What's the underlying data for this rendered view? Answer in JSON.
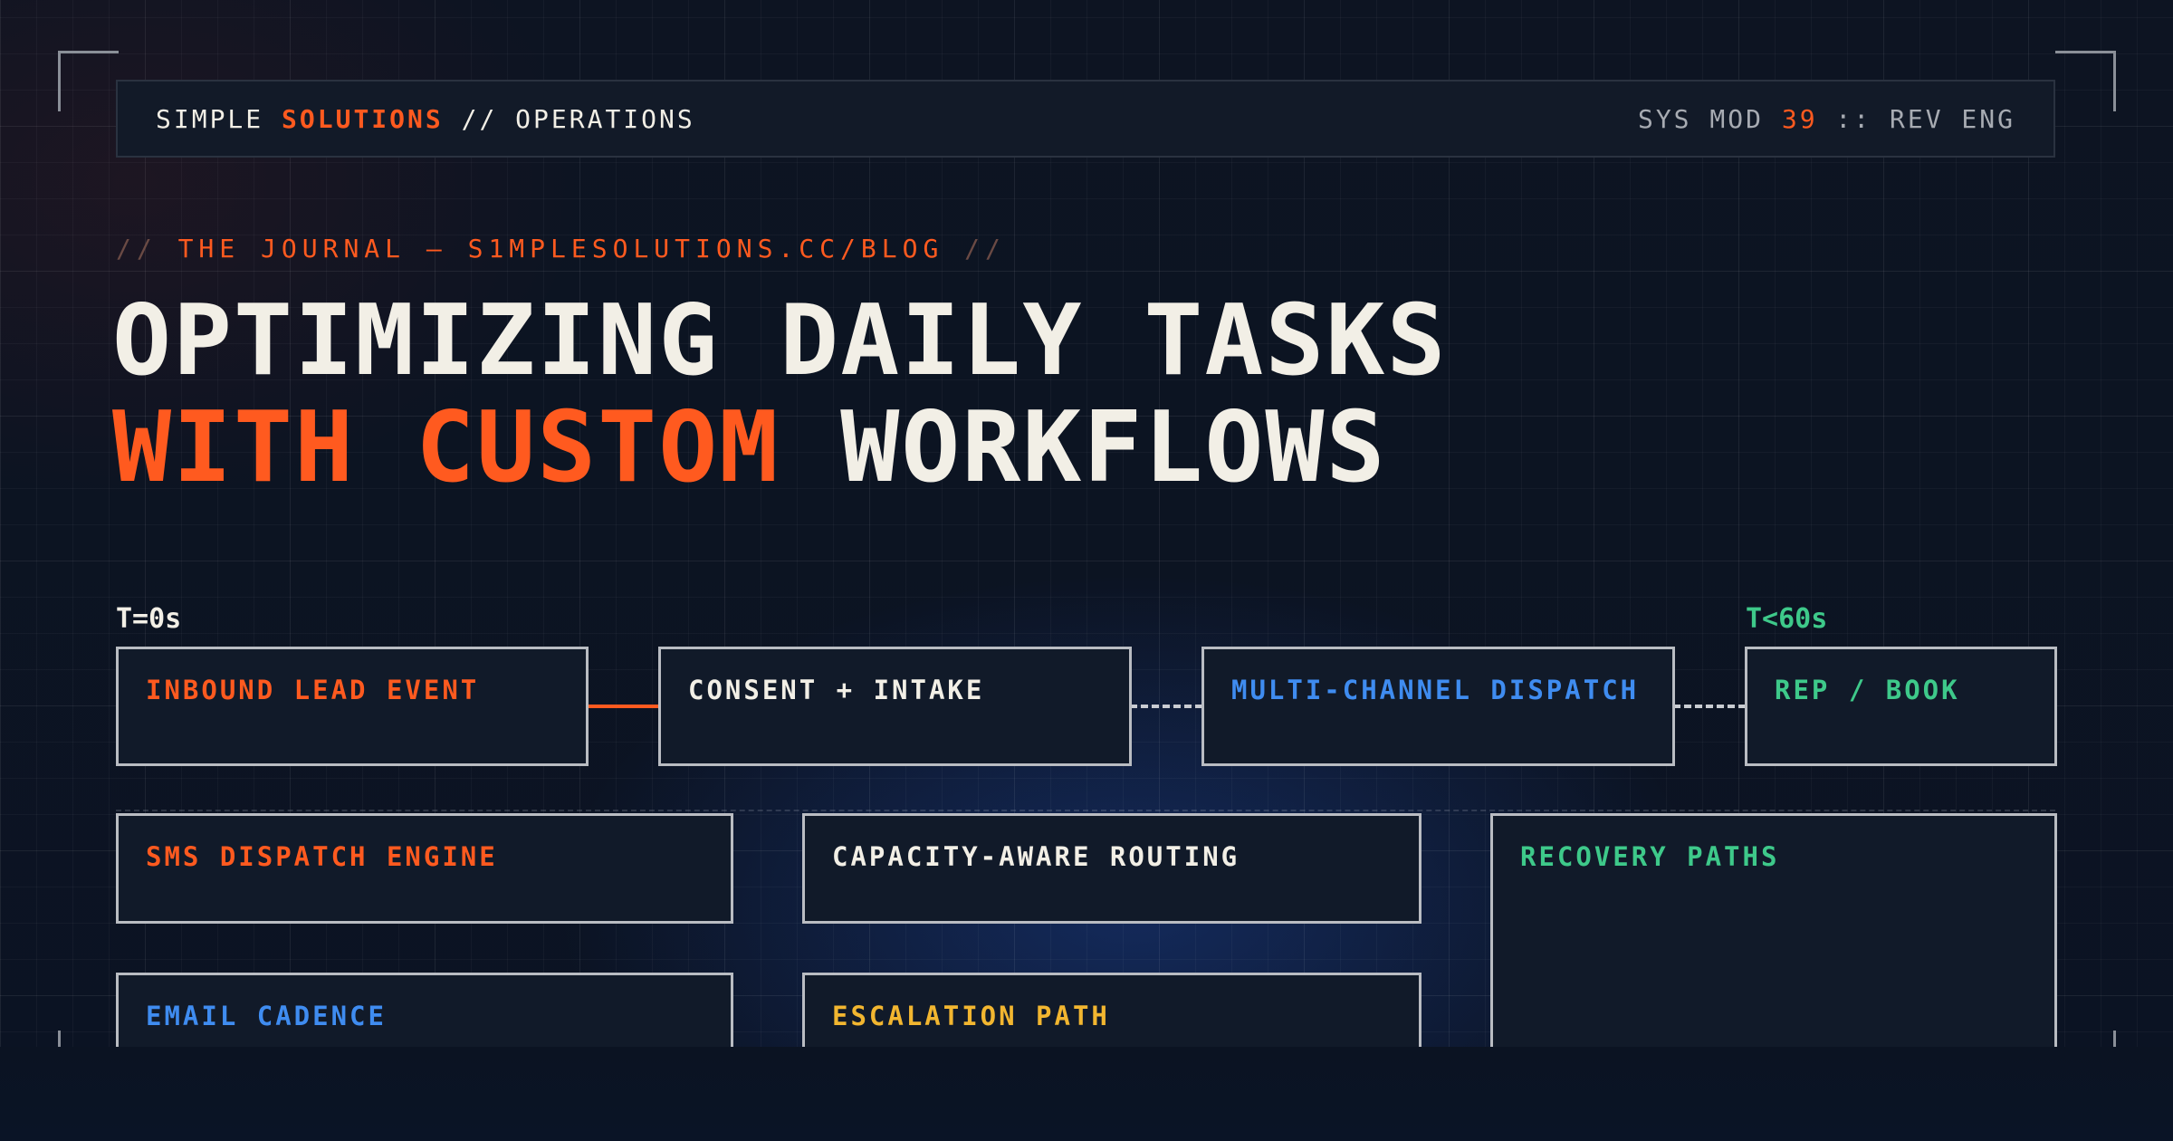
{
  "header": {
    "brand_a": "SIMPLE",
    "brand_b": "SOLUTIONS",
    "brand_c": "// OPERATIONS",
    "sys_prefix": "SYS MOD",
    "sys_number": "39",
    "sys_suffix": ":: REV ENG"
  },
  "kicker": {
    "open": "//",
    "text": "THE JOURNAL — S1MPLESOLUTIONS.CC/BLOG",
    "close": "//"
  },
  "headline": {
    "line1": "OPTIMIZING DAILY TASKS",
    "line2_accent": "WITH CUSTOM",
    "line2_rest": "WORKFLOWS"
  },
  "timeline": {
    "start_label": "T=0s",
    "end_label": "T<60s",
    "steps": [
      {
        "label": "INBOUND LEAD EVENT",
        "color": "#ff5a1f"
      },
      {
        "label": "CONSENT + INTAKE",
        "color": "#f2efe6"
      },
      {
        "label": "MULTI-CHANNEL DISPATCH",
        "color": "#3f8cf0"
      },
      {
        "label": "REP / BOOK",
        "color": "#3ec98a"
      }
    ]
  },
  "modules": [
    {
      "label": "SMS DISPATCH ENGINE",
      "color": "#ff5a1f"
    },
    {
      "label": "CAPACITY-AWARE ROUTING",
      "color": "#f2efe6"
    },
    {
      "label": "RECOVERY PATHS",
      "color": "#3ec98a"
    },
    {
      "label": "EMAIL CADENCE",
      "color": "#3f8cf0"
    },
    {
      "label": "ESCALATION PATH",
      "color": "#f2b630"
    }
  ],
  "colors": {
    "accent": "#ff5a1f",
    "blue": "#3f8cf0",
    "green": "#3ec98a",
    "yellow": "#f2b630",
    "background": "#0b1220"
  }
}
